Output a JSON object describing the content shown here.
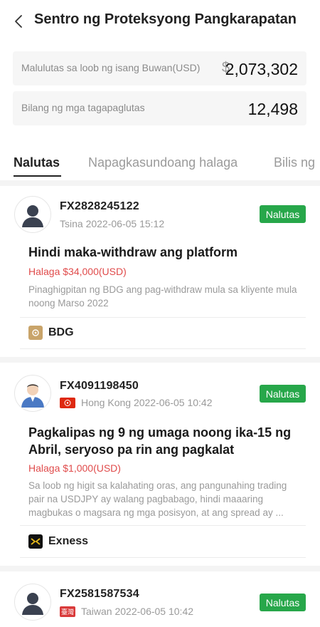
{
  "header": {
    "title": "Sentro ng Proteksyong Pangkarapatan"
  },
  "stats": {
    "monthly": {
      "label": "Malulutas sa loob ng isang Buwan(USD)",
      "currency": "$",
      "value": "2,073,302"
    },
    "users": {
      "label": "Bilang ng mga tagapaglutas",
      "value": "12,498"
    }
  },
  "tabs": [
    {
      "label": "Nalutas",
      "active": true
    },
    {
      "label": "Napagkasundoang halaga",
      "active": false
    },
    {
      "label": "Bilis ng",
      "active": false
    }
  ],
  "cases": [
    {
      "id": "FX2828245122",
      "region": "Tsina",
      "date": "2022-06-05 15:12",
      "status": "Nalutas",
      "title": "Hindi maka-withdraw ang platform",
      "amount": "Halaga $34,000(USD)",
      "description": "Pinaghigpitan ng BDG ang pag-withdraw mula sa kliyente mula noong Marso 2022",
      "broker": "BDG"
    },
    {
      "id": "FX4091198450",
      "region": "Hong Kong",
      "date": "2022-06-05 10:42",
      "status": "Nalutas",
      "title": "Pagkalipas ng 9 ng umaga noong ika-15 ng Abril, seryoso pa rin ang pagkalat",
      "amount": "Halaga $1,000(USD)",
      "description": "Sa loob ng higit sa kalahating oras, ang pangunahing trading pair na USDJPY ay walang pagbabago, hindi maaaring magbukas o magsara ng mga posisyon, at ang spread ay ...",
      "broker": "Exness"
    },
    {
      "id": "FX2581587534",
      "region": "Taiwan",
      "date": "2022-06-05 10:42",
      "status": "Nalutas",
      "flag_text": "臺灣"
    }
  ],
  "colors": {
    "resolved": "#27a74a",
    "amount": "#e04b4b"
  }
}
